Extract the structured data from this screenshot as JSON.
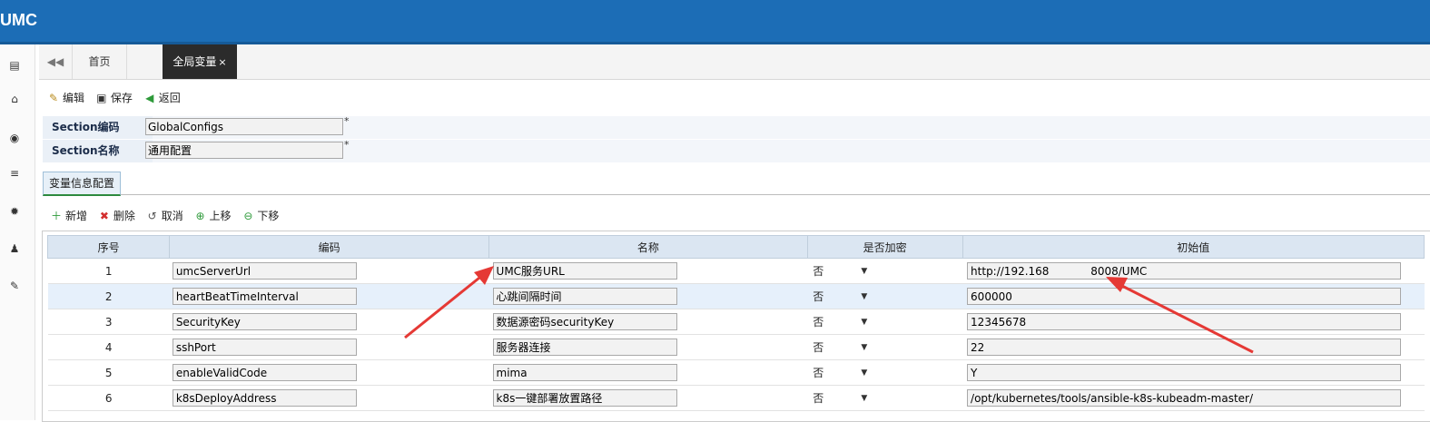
{
  "app": {
    "brand": "UMC"
  },
  "tabs": {
    "prev_icon": "double-left-icon",
    "home": "首页",
    "active": "全局变量",
    "close": "×"
  },
  "toolbar": {
    "edit": "编辑",
    "save": "保存",
    "back": "返回"
  },
  "form": {
    "code_label": "Section编码",
    "code_value": "GlobalConfigs",
    "name_label": "Section名称",
    "name_value": "通用配置",
    "required_mark": "*"
  },
  "subtabs": [
    {
      "label": "变量信息配置"
    }
  ],
  "grid_toolbar": {
    "add": "新增",
    "delete": "删除",
    "cancel": "取消",
    "up": "上移",
    "down": "下移"
  },
  "grid": {
    "headers": [
      "序号",
      "编码",
      "名称",
      "是否加密",
      "初始值"
    ],
    "rows": [
      {
        "no": "1",
        "code": "umcServerUrl",
        "name": "UMC服务URL",
        "encrypt": "否",
        "value": "http://192.168            8008/UMC"
      },
      {
        "no": "2",
        "code": "heartBeatTimeInterval",
        "name": "心跳间隔时间",
        "encrypt": "否",
        "value": "600000"
      },
      {
        "no": "3",
        "code": "SecurityKey",
        "name": "数据源密码securityKey",
        "encrypt": "否",
        "value": "12345678"
      },
      {
        "no": "4",
        "code": "sshPort",
        "name": "服务器连接",
        "encrypt": "否",
        "value": "22"
      },
      {
        "no": "5",
        "code": "enableValidCode",
        "name": "mima",
        "encrypt": "否",
        "value": "Y"
      },
      {
        "no": "6",
        "code": "k8sDeployAddress",
        "name": "k8s一键部署放置路径",
        "encrypt": "否",
        "value": "/opt/kubernetes/tools/ansible-k8s-kubeadm-master/"
      }
    ]
  },
  "colors": {
    "topbar": "#1c6db6",
    "header_bg": "#dbe6f2",
    "arrow": "#e53935",
    "active_tab": "#2b2b2b"
  }
}
